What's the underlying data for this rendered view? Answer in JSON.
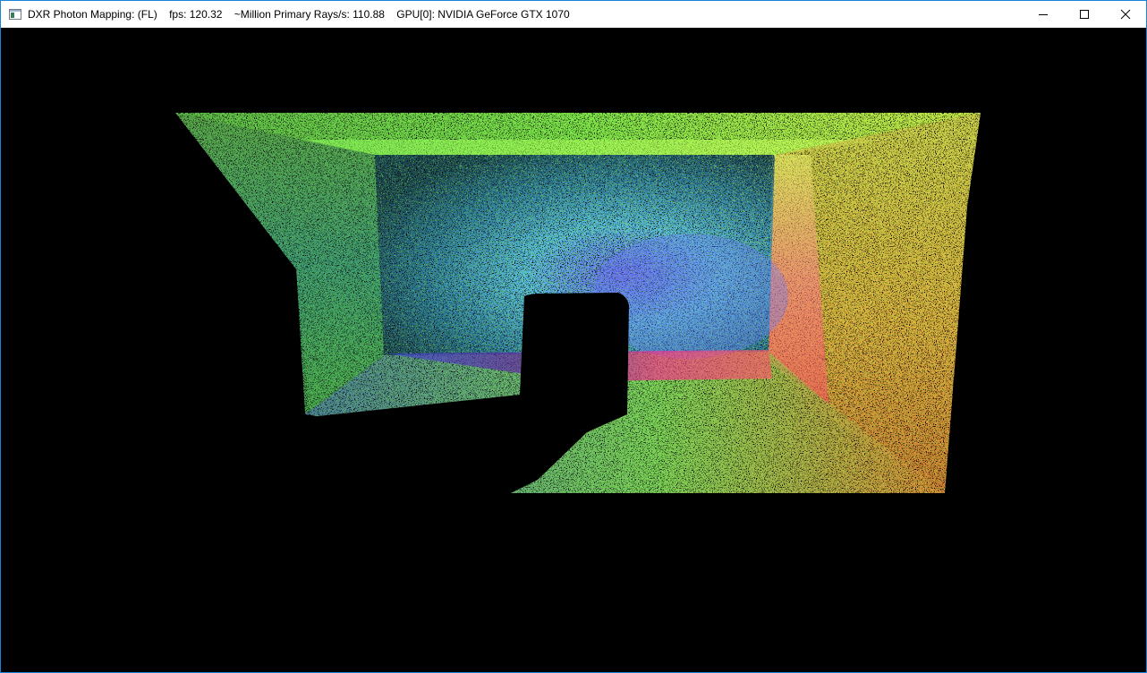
{
  "window": {
    "title": "DXR Photon Mapping: (FL)    fps: 120.32    ~Million Primary Rays/s: 110.88    GPU[0]: NVIDIA GeForce GTX 1070",
    "accent_border": "#1883d7"
  },
  "titlebar": {
    "app_icon": "window-app-icon",
    "controls": [
      {
        "name": "minimize",
        "icon": "minimize-icon"
      },
      {
        "name": "maximize",
        "icon": "maximize-icon"
      },
      {
        "name": "close",
        "icon": "close-icon"
      }
    ]
  },
  "viewport": {
    "background": "#000000",
    "scene": "photon-mapped-cornell-box"
  }
}
